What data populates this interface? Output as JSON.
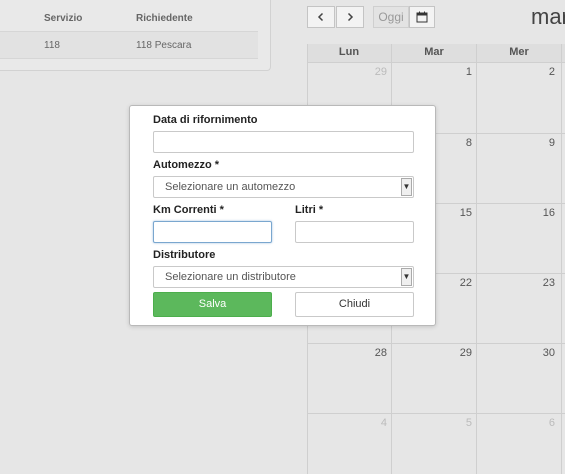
{
  "table": {
    "headers": [
      "Servizio",
      "Richiedente"
    ],
    "rows": [
      [
        "118",
        "118 Pescara"
      ]
    ]
  },
  "calendar": {
    "prev_icon": "chevron-left-icon",
    "next_icon": "chevron-right-icon",
    "prev_label": "<",
    "next_label": ">",
    "today_label": "Oggi",
    "calendar_icon": "calendar-icon",
    "month_title": "mar",
    "days_of_week": [
      "Lun",
      "Mar",
      "Mer"
    ],
    "weeks": [
      [
        "29",
        "1",
        "2"
      ],
      [
        "",
        "8",
        "9"
      ],
      [
        "",
        "15",
        "16"
      ],
      [
        "",
        "22",
        "23"
      ],
      [
        "28",
        "29",
        "30"
      ],
      [
        "4",
        "5",
        "6"
      ]
    ]
  },
  "modal": {
    "date_label": "Data di rifornimento",
    "date_value": "",
    "vehicle_label": "Automezzo *",
    "vehicle_selected": "Selezionare un automezzo",
    "km_label": "Km Correnti *",
    "km_value": "",
    "liters_label": "Litri *",
    "liters_value": "",
    "distributor_label": "Distributore",
    "distributor_selected": "Selezionare un distributore",
    "dropdown_arrow": "chevron-down-icon",
    "save_label": "Salva",
    "close_label": "Chiudi",
    "save_color": "#5cb85c"
  }
}
